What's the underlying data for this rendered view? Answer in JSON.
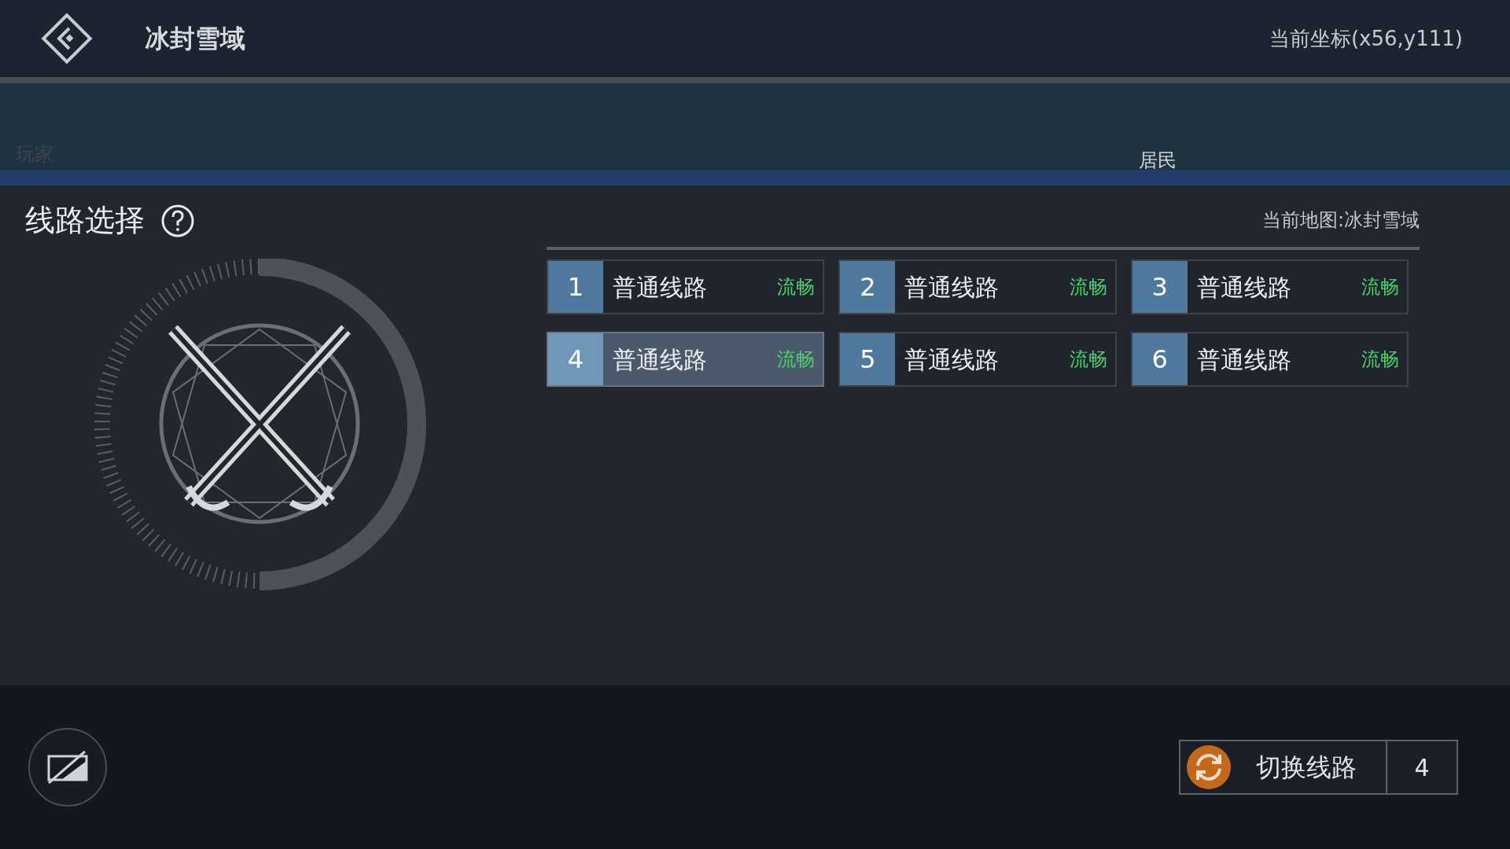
{
  "header": {
    "title": "冰封雪域",
    "coordinates": "当前坐标(x56,y111)"
  },
  "map": {
    "label": "居民",
    "sidebar_items": [
      "玩家"
    ]
  },
  "panel": {
    "title": "线路选择",
    "current_map": "当前地图:冰封雪域",
    "lines": [
      {
        "number": "1",
        "name": "普通线路",
        "status": "流畅",
        "selected": false
      },
      {
        "number": "2",
        "name": "普通线路",
        "status": "流畅",
        "selected": false
      },
      {
        "number": "3",
        "name": "普通线路",
        "status": "流畅",
        "selected": false
      },
      {
        "number": "4",
        "name": "普通线路",
        "status": "流畅",
        "selected": true
      },
      {
        "number": "5",
        "name": "普通线路",
        "status": "流畅",
        "selected": false
      },
      {
        "number": "6",
        "name": "普通线路",
        "status": "流畅",
        "selected": false
      }
    ]
  },
  "switch_button": {
    "label": "切换线路",
    "value": "4"
  }
}
